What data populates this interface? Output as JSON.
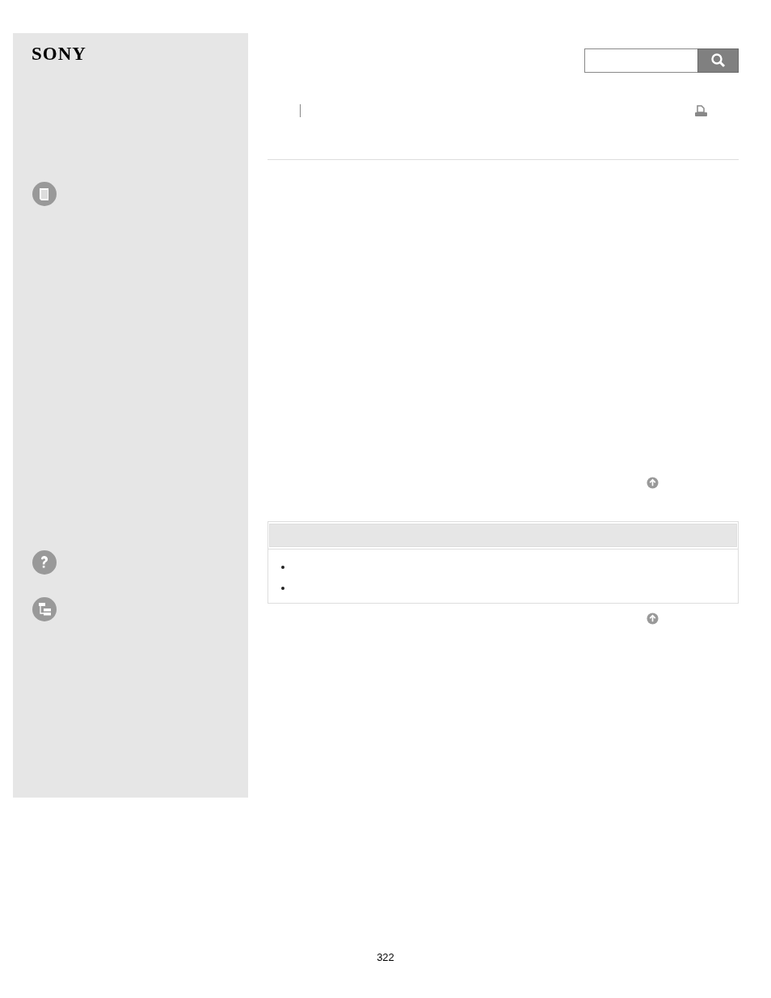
{
  "sidebar": {
    "logo": "SONY",
    "nav_icons": [
      {
        "kind": "book"
      },
      {
        "kind": "help"
      },
      {
        "kind": "tree"
      }
    ]
  },
  "notes_box": {
    "bullets": [
      {
        "kind": "dot"
      },
      {
        "kind": "dot"
      }
    ]
  },
  "page_number": "322"
}
